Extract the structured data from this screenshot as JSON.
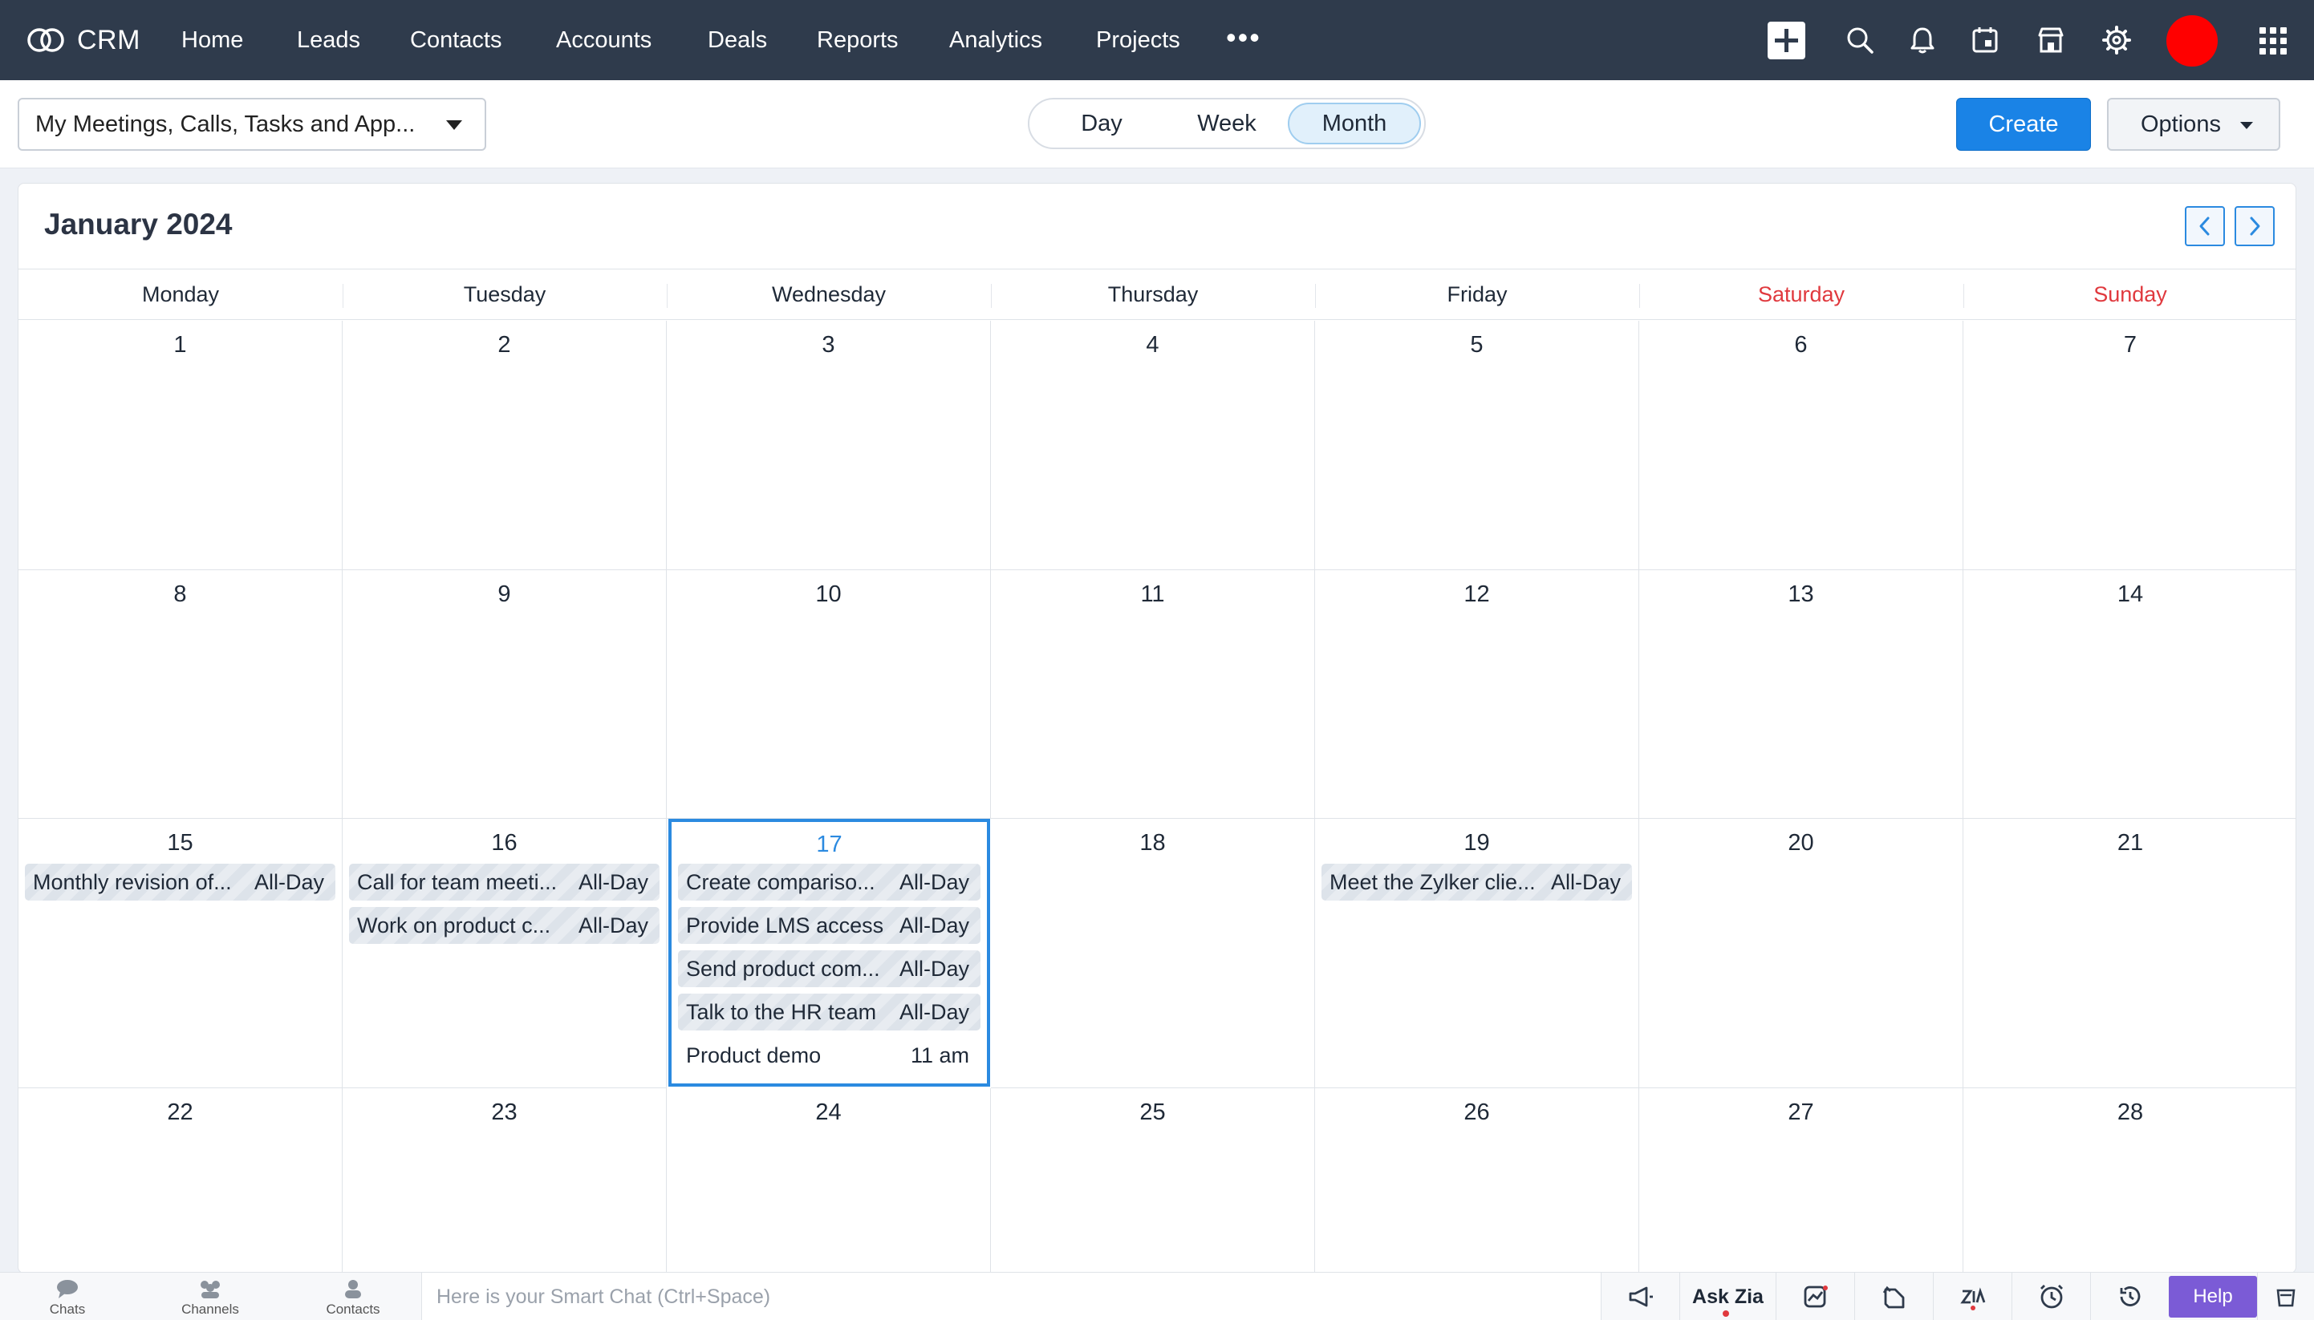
{
  "app": {
    "brand_name": "CRM",
    "nav_items": [
      "Home",
      "Leads",
      "Contacts",
      "Accounts",
      "Deals",
      "Reports",
      "Analytics",
      "Projects"
    ],
    "more_label": "•••",
    "avatar_color": "#ff0000",
    "nav_bg": "#2f3b4c",
    "icons": [
      "plus-icon",
      "search-icon",
      "bell-icon",
      "calendar-icon",
      "marketplace-icon",
      "gear-icon",
      "apps-grid-icon"
    ]
  },
  "toolbar": {
    "filter_value": "My Meetings, Calls, Tasks and App...",
    "views": [
      "Day",
      "Week",
      "Month"
    ],
    "active_view": "Month",
    "create_label": "Create",
    "options_label": "Options",
    "accent_color": "#1a83e6"
  },
  "calendar": {
    "title": "January 2024",
    "weekdays": [
      "Monday",
      "Tuesday",
      "Wednesday",
      "Thursday",
      "Friday",
      "Saturday",
      "Sunday"
    ],
    "weekend_color": "#e0393e",
    "today": "17",
    "weeks": [
      [
        "1",
        "2",
        "3",
        "4",
        "5",
        "6",
        "7"
      ],
      [
        "8",
        "9",
        "10",
        "11",
        "12",
        "13",
        "14"
      ],
      [
        "15",
        "16",
        "17",
        "18",
        "19",
        "20",
        "21"
      ],
      [
        "22",
        "23",
        "24",
        "25",
        "26",
        "27",
        "28"
      ]
    ],
    "events": {
      "15": [
        {
          "title": "Monthly revision of...",
          "time": "All-Day"
        }
      ],
      "16": [
        {
          "title": "Call for team meeti...",
          "time": "All-Day"
        },
        {
          "title": "Work on product c...",
          "time": "All-Day"
        }
      ],
      "17": [
        {
          "title": "Create compariso...",
          "time": "All-Day"
        },
        {
          "title": "Provide LMS access",
          "time": "All-Day"
        },
        {
          "title": "Send product com...",
          "time": "All-Day"
        },
        {
          "title": "Talk to the HR team",
          "time": "All-Day"
        },
        {
          "title": "Product demo",
          "time": "11 am",
          "plain": true
        }
      ],
      "19": [
        {
          "title": "Meet the Zylker clie...",
          "time": "All-Day"
        }
      ]
    }
  },
  "bottom_bar": {
    "items": [
      "Chats",
      "Channels",
      "Contacts"
    ],
    "smart_chat_placeholder": "Here is your Smart Chat (Ctrl+Space)",
    "ask_zia_label": "Ask Zia",
    "help_label": "Help",
    "help_color": "#7b5bd6"
  }
}
